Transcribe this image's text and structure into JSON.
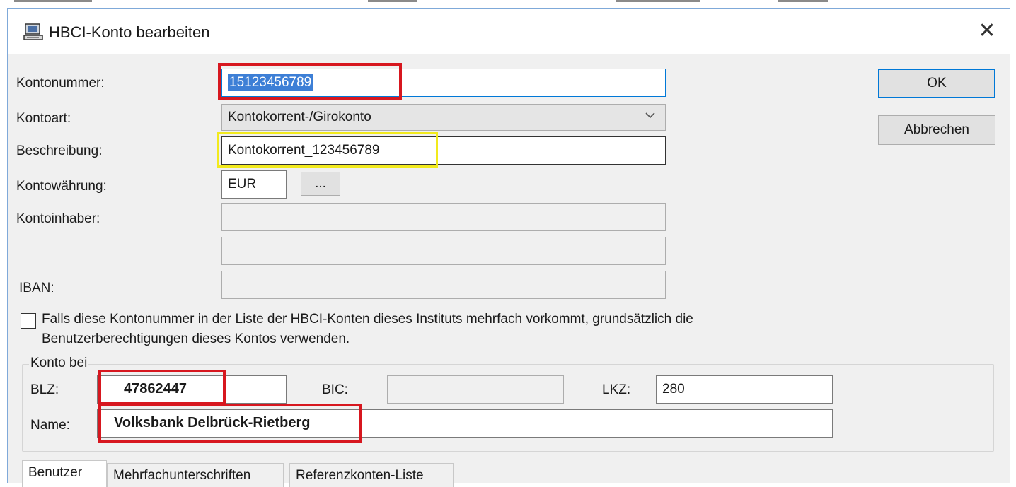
{
  "window": {
    "title": "HBCI-Konto bearbeiten",
    "close_glyph": "✕"
  },
  "form": {
    "kontonummer_label": "Kontonummer:",
    "kontonummer_value": "15123456789",
    "kontoart_label": "Kontoart:",
    "kontoart_value": "Kontokorrent-/Girokonto",
    "beschreibung_label": "Beschreibung:",
    "beschreibung_value": "Kontokorrent_123456789",
    "kontowaehrung_label": "Kontowährung:",
    "kontowaehrung_value": "EUR",
    "currency_button_label": "...",
    "kontoinhaber_label": "Kontoinhaber:",
    "kontoinhaber_value": "",
    "kontoinhaber2_value": "",
    "iban_label": "IBAN:",
    "iban_value": "",
    "checkbox_line1": "Falls diese Kontonummer in der Liste der HBCI-Konten dieses Instituts mehrfach vorkommt, grundsätzlich die",
    "checkbox_line2": "Benutzerberechtigungen dieses Kontos verwenden.",
    "checkbox_checked": false
  },
  "buttons": {
    "ok": "OK",
    "cancel": "Abbrechen"
  },
  "bank": {
    "group_title": "Konto bei",
    "blz_label": "BLZ:",
    "blz_value": "47862447",
    "bic_label": "BIC:",
    "bic_value": "",
    "lkz_label": "LKZ:",
    "lkz_value": "280",
    "name_label": "Name:",
    "name_value": "Volksbank Delbrück-Rietberg"
  },
  "tabs": [
    {
      "label": "Benutzer"
    },
    {
      "label": "Mehrfachunterschriften"
    },
    {
      "label": "Referenzkonten-Liste"
    }
  ],
  "colors": {
    "highlight_red": "#d7171f",
    "highlight_yellow": "#f2ea1d",
    "selection_blue": "#3d7fd6",
    "focus_border": "#0078d7"
  }
}
